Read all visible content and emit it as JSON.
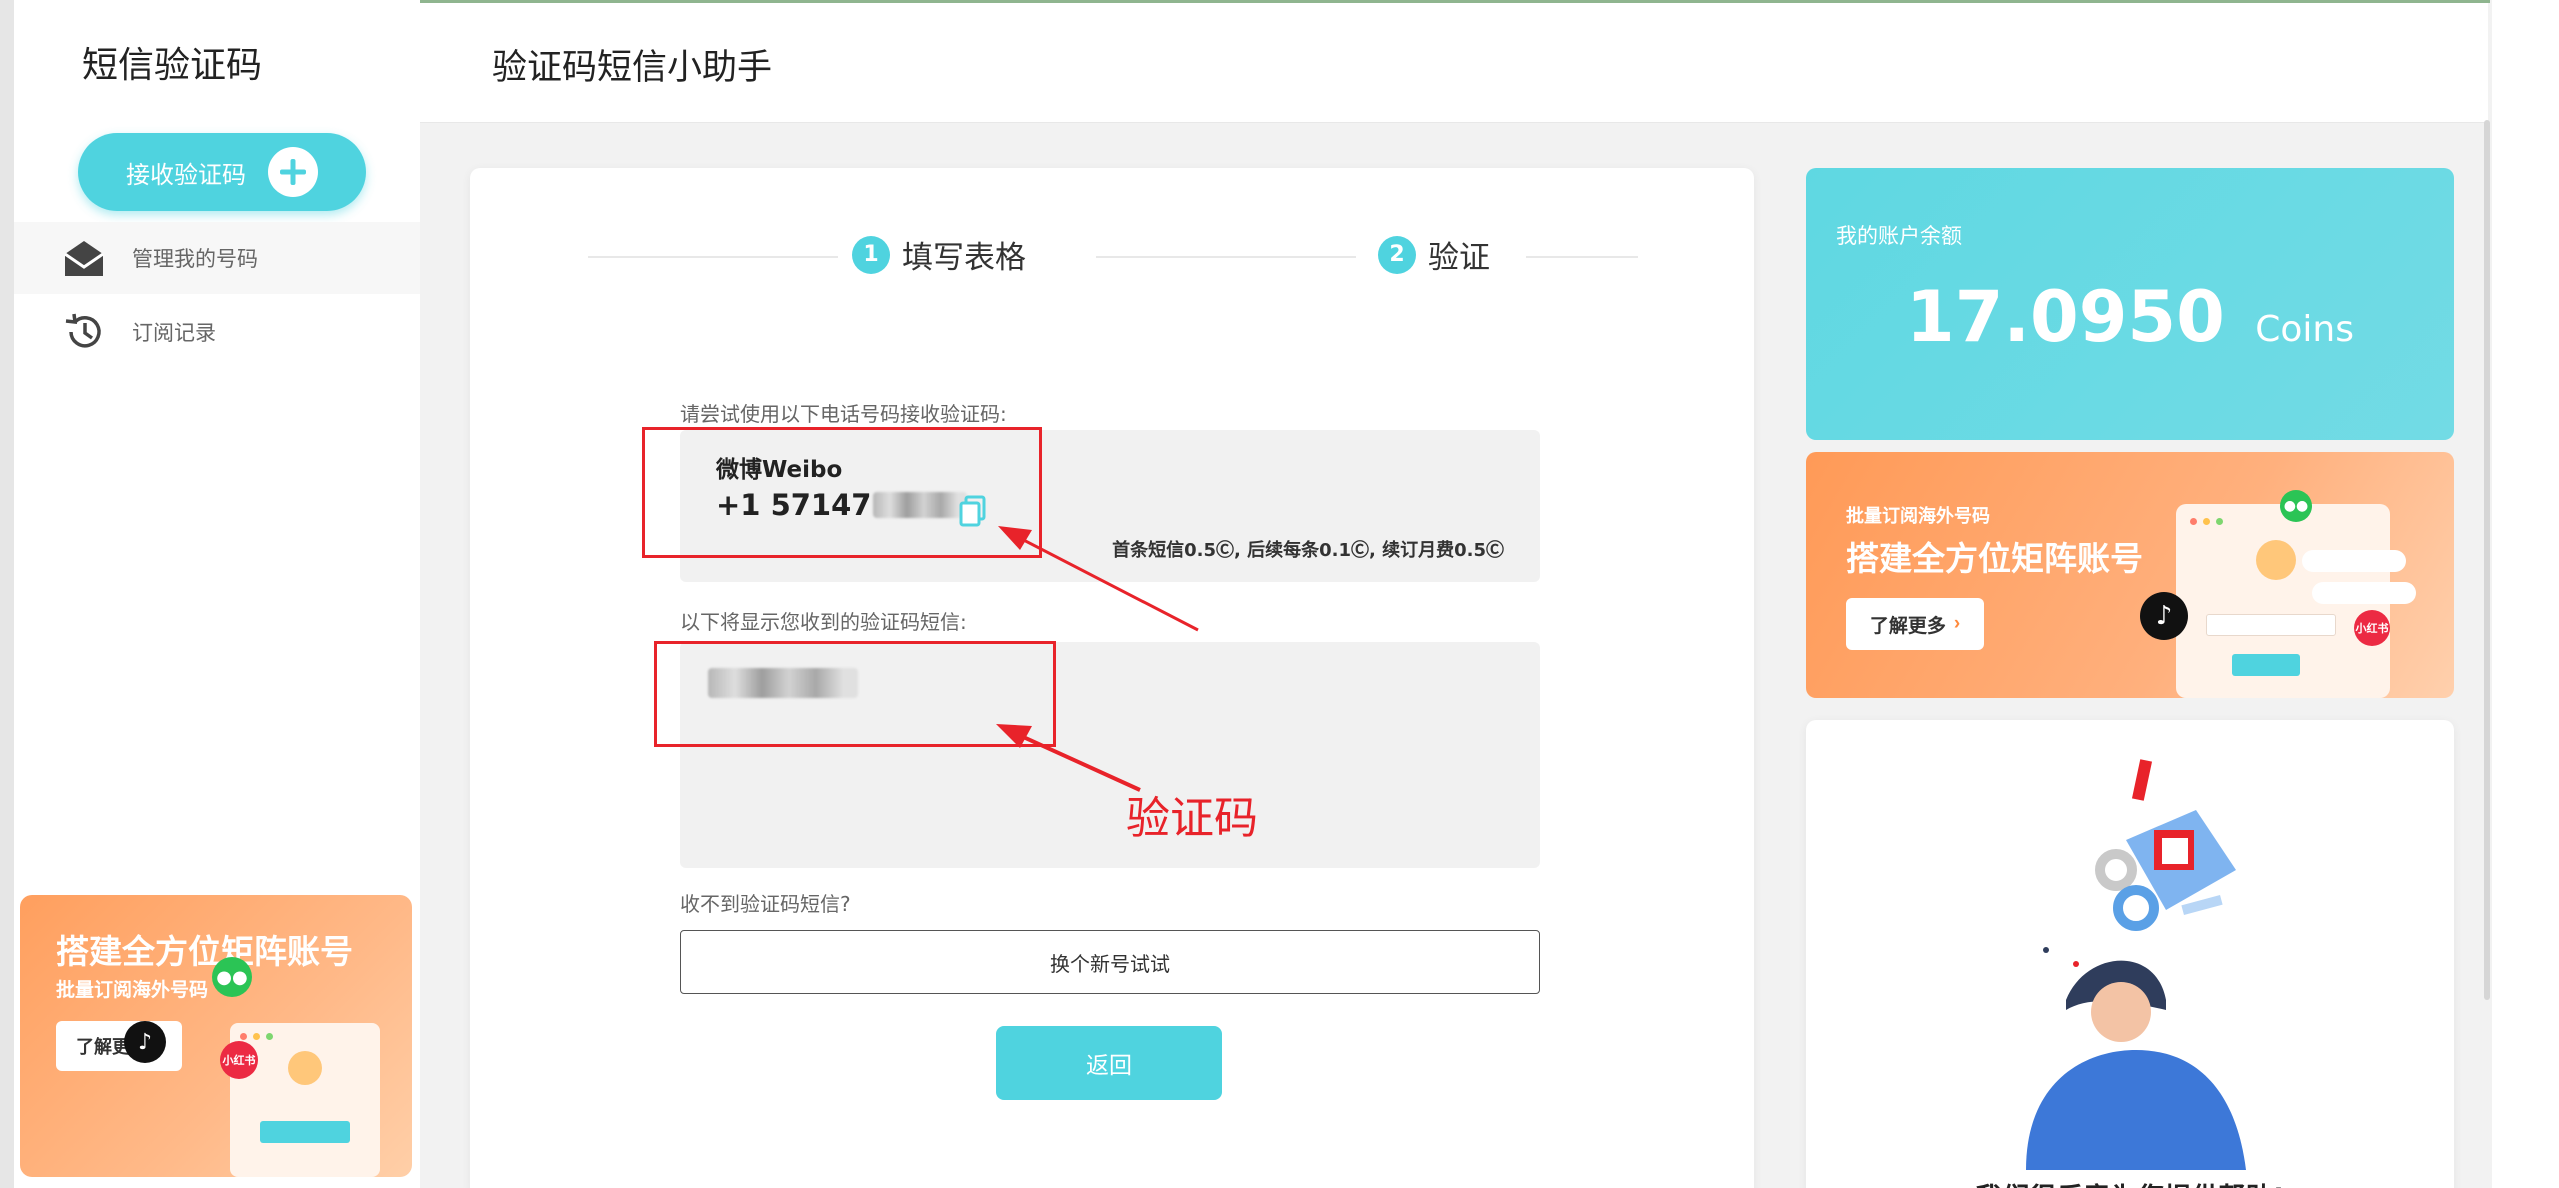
{
  "sidebar": {
    "brand": "短信验证码",
    "receive_button": "接收验证码",
    "nav": [
      {
        "label": "管理我的号码",
        "icon": "envelope-open-icon"
      },
      {
        "label": "订阅记录",
        "icon": "history-icon"
      }
    ],
    "promo": {
      "title": "搭建全方位矩阵账号",
      "subtitle": "批量订阅海外号码",
      "button": "了解更多",
      "badge_xhs": "小红书"
    }
  },
  "header": {
    "title": "验证码短信小助手"
  },
  "main": {
    "steps": [
      {
        "num": "1",
        "label": "填写表格"
      },
      {
        "num": "2",
        "label": "验证"
      }
    ],
    "phone_label": "请尝试使用以下电话号码接收验证码:",
    "service": "微博Weibo",
    "phone_prefix": "+1 57147",
    "price_note": "首条短信0.5Ⓒ, 后续每条0.1Ⓒ, 续订月费0.5Ⓒ",
    "sms_label": "以下将显示您收到的验证码短信:",
    "no_sms_label": "收不到验证码短信?",
    "swap_button": "换个新号试试",
    "back_button": "返回"
  },
  "annotation": {
    "text": "验证码",
    "color": "#e8232a"
  },
  "right": {
    "balance_label": "我的账户余额",
    "balance_value": "17.0950",
    "balance_unit": "Coins",
    "promo": {
      "subtitle": "批量订阅海外号码",
      "title": "搭建全方位矩阵账号",
      "button": "了解更多",
      "badge_xhs": "小红书"
    },
    "help_text": "我们很乐意为您提供帮助!"
  },
  "colors": {
    "accent": "#4fd3df",
    "promo": "#ff9f5e",
    "annotation": "#e8232a"
  }
}
